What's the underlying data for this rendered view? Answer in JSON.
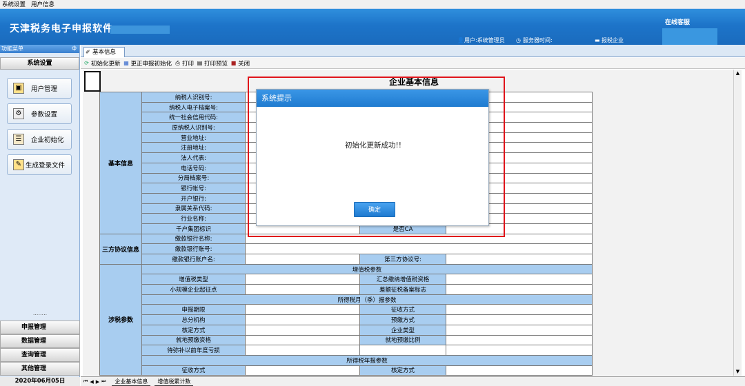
{
  "menubar": {
    "items": [
      "系统设置",
      "用户信息"
    ]
  },
  "banner": {
    "title": "天津税务电子申报软件",
    "online_service": "在线客服",
    "user": "用户:系统管理员",
    "server_time": "服务器时间:",
    "tax_enterprise": "报税企业"
  },
  "sidebar": {
    "header": "功能菜单",
    "header_pin": "ф",
    "section": "系统设置",
    "items": [
      {
        "label": "用户管理",
        "icon": "user-icon"
      },
      {
        "label": "参数设置",
        "icon": "wrench-icon"
      },
      {
        "label": "企业初始化",
        "icon": "clipboard-icon"
      },
      {
        "label": "生成登录文件",
        "icon": "document-icon"
      }
    ],
    "dots": "........",
    "bottom": [
      "申报管理",
      "数据管理",
      "查询管理",
      "其他管理"
    ],
    "date": "2020年06月05日"
  },
  "tabs": [
    {
      "label": "基本信息",
      "icon": "pencil-icon"
    }
  ],
  "toolbar": [
    {
      "label": "初始化更新",
      "icon": "refresh-icon"
    },
    {
      "label": "更正申报初始化",
      "icon": "edit-icon"
    },
    {
      "label": "打印",
      "icon": "printer-icon"
    },
    {
      "label": "打印预览",
      "icon": "preview-icon"
    },
    {
      "label": "关闭",
      "icon": "close-icon"
    }
  ],
  "form": {
    "title": "企业基本信息",
    "basic_section": "基本信息",
    "basic_labels": [
      "纳税人识别号:",
      "纳税人电子档案号:",
      "统一社会信用代码:",
      "原纳税人识别号:",
      "营业地址:",
      "注册地址:",
      "法人代表:",
      "电话号码:",
      "分局档案号:",
      "银行帐号:",
      "开户银行:",
      "隶属关系代码:",
      "行业名称:",
      "千户集团标识"
    ],
    "ca_label": "是否CA",
    "tripartite_section": "三方协议信息",
    "tripartite_labels": [
      "缴款银行名称:",
      "缴款银行账号:",
      "缴款银行账户名:"
    ],
    "tripartite_no": "第三方协议号:",
    "tax_section": "涉税参数",
    "vat_header": "增值税参数",
    "vat_rows": [
      [
        "增值税类型",
        "汇总缴纳增值税资格"
      ],
      [
        "小规模企业起征点",
        "差额征税备案标志"
      ]
    ],
    "cit_header": "所得税月（季）报参数",
    "cit_rows": [
      [
        "申报期限",
        "征收方式"
      ],
      [
        "总分机构",
        "预缴方式"
      ],
      [
        "核定方式",
        "企业类型"
      ],
      [
        "就地预缴资格",
        "就地预缴比例"
      ],
      [
        "待弥补以前年度亏损",
        ""
      ]
    ],
    "annual_header": "所得税年报参数",
    "annual_rows": [
      [
        "征收方式",
        "核定方式"
      ]
    ]
  },
  "dialog": {
    "title": "系统提示",
    "message": "初始化更新成功!!",
    "ok": "确定"
  },
  "sheets": [
    "企业基本信息",
    "增值税累计数"
  ],
  "sheet_nav": [
    "⏮",
    "◀",
    "▶",
    "⏭"
  ]
}
